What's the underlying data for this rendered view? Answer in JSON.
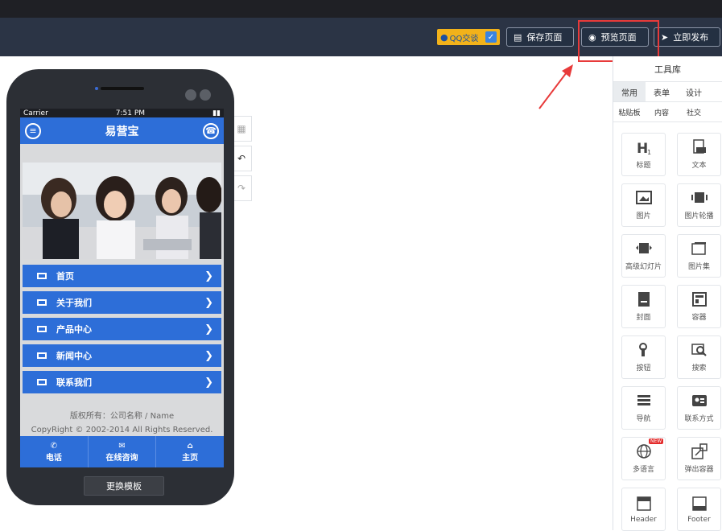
{
  "toolbar": {
    "qq_label": "QQ交谈",
    "save_label": "保存页面",
    "preview_label": "预览页面",
    "publish_label": "立即发布"
  },
  "panel": {
    "title": "工具库",
    "tabs": [
      "常用",
      "表单",
      "设计"
    ],
    "subtabs": [
      "粘贴板",
      "内容",
      "社交"
    ],
    "widgets": [
      {
        "label": "标题",
        "icon": "heading-icon"
      },
      {
        "label": "文本",
        "icon": "text-file-icon"
      },
      {
        "label": "图片",
        "icon": "image-icon"
      },
      {
        "label": "图片轮播",
        "icon": "image-carousel-icon"
      },
      {
        "label": "高级幻灯片",
        "icon": "slideshow-icon"
      },
      {
        "label": "图片集",
        "icon": "gallery-icon"
      },
      {
        "label": "封面",
        "icon": "cover-icon"
      },
      {
        "label": "容器",
        "icon": "container-icon"
      },
      {
        "label": "按钮",
        "icon": "tap-button-icon"
      },
      {
        "label": "搜索",
        "icon": "search-icon"
      },
      {
        "label": "导航",
        "icon": "navigation-icon"
      },
      {
        "label": "联系方式",
        "icon": "contact-icon"
      },
      {
        "label": "多语言",
        "icon": "globe-icon",
        "badge": "NEW"
      },
      {
        "label": "弹出容器",
        "icon": "popup-icon"
      },
      {
        "label": "Header",
        "icon": "header-icon"
      },
      {
        "label": "Footer",
        "icon": "footer-icon"
      }
    ]
  },
  "phone": {
    "status": {
      "carrier": "Carrier",
      "time": "7:51 PM"
    },
    "app_title": "易营宝",
    "menu": [
      "首页",
      "关于我们",
      "产品中心",
      "新闻中心",
      "联系我们"
    ],
    "copyright_line1": "版权所有：公司名称 / Name",
    "copyright_line2": "CopyRight © 2002-2014 All Rights Reserved.",
    "bottom_nav": [
      "电话",
      "在线咨询",
      "主页"
    ],
    "change_template": "更换模板"
  }
}
